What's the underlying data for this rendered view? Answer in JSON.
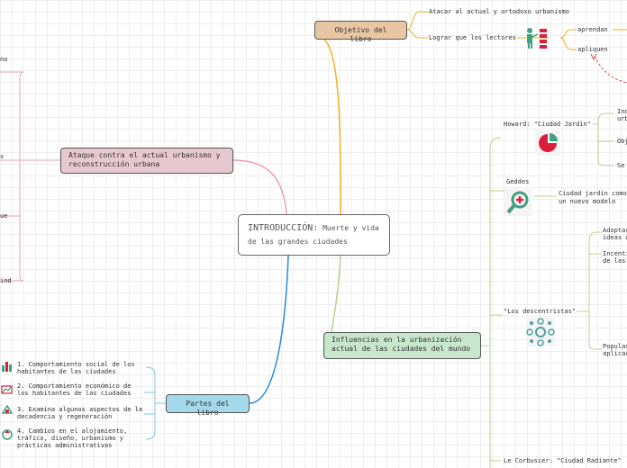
{
  "center": {
    "title": "INTRODUCCIÓN:",
    "subtitle_1": "Muerte y vida",
    "subtitle_2": "de las grandes ciudades"
  },
  "objetivo": {
    "label": "Objetivo del libro",
    "items": [
      "Atacar al actual y ortodoxo urbanismo",
      "Lograr que los lectores"
    ],
    "sub": [
      "aprendan",
      "apliquen"
    ]
  },
  "ataque": {
    "line_1": "Ataque contra el actual urbanismo y",
    "line_2": "reconstrucción urbana",
    "fragments": [
      "no",
      "s",
      "ue",
      "ind"
    ]
  },
  "influencias": {
    "line_1": "Influencias en la urbanización",
    "line_2": "actual de las ciudades del mundo",
    "howard": {
      "label": "Howard: \"Ciudad Jardín\"",
      "frags": [
        "Ind",
        "urb",
        "Obj",
        "Se"
      ]
    },
    "geddes": {
      "label": "Geddes",
      "desc_1": "Ciudad jardín como",
      "desc_2": "un nuevo modelo"
    },
    "descentristas": {
      "label": "\"Los descentristas\"",
      "frags": [
        "Adoptar",
        "ideas d",
        "Incenti",
        "de las",
        "Popular",
        "aplicac"
      ]
    },
    "corbusier": {
      "label": "Le Corbusier: \"Ciudad Radiante\""
    }
  },
  "partes": {
    "label": "Partes del libro",
    "items": [
      {
        "l1": "1. Comportamiento social de los",
        "l2": "habitantes de las ciudades"
      },
      {
        "l1": "2. Comportamiento económico de",
        "l2": "los habitantes de las ciudades"
      },
      {
        "l1": "3. Examina algunos aspectos de la",
        "l2": "decadencia y regeneración"
      },
      {
        "l1": "4. Cambios en el alojamiento,",
        "l2": "tráfico, diseño, urbanismo y",
        "l3": "prácticas administrativas"
      }
    ]
  },
  "colors": {
    "objetivo": "#f0b020",
    "ataque": "#e8a0b4",
    "influencias": "#b8d08c",
    "partes": "#2a8ad0",
    "pie_red": "#d81e3c",
    "bar_red": "#d81e3c",
    "magnifier": "#40a080",
    "dots": "#50a0a0"
  }
}
